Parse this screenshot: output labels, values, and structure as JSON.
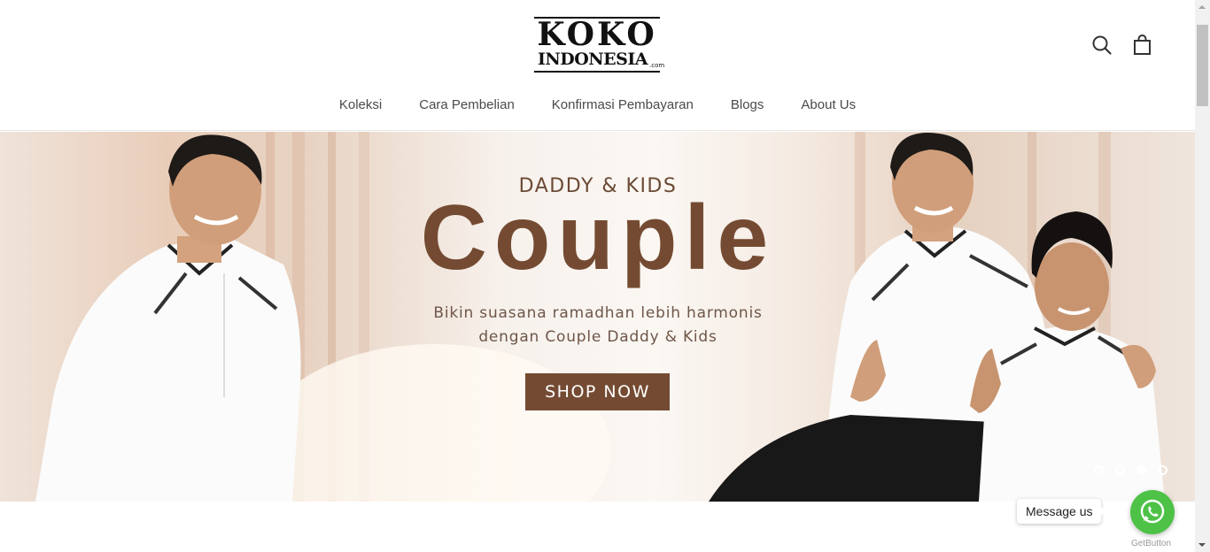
{
  "brand": {
    "logo_line1": "KOKO",
    "logo_line2": "INDONESIA",
    "logo_suffix": ".com"
  },
  "header": {
    "icons": [
      "search-icon",
      "shopping-bag-icon"
    ]
  },
  "nav": {
    "items": [
      {
        "label": "Koleksi"
      },
      {
        "label": "Cara Pembelian"
      },
      {
        "label": "Konfirmasi Pembayaran"
      },
      {
        "label": "Blogs"
      },
      {
        "label": "About Us"
      }
    ]
  },
  "hero": {
    "eyebrow": "DADDY & KIDS",
    "headline": "Couple",
    "subtext_line1": "Bikin suasana ramadhan lebih harmonis",
    "subtext_line2": "dengan Couple Daddy & Kids",
    "cta_label": "SHOP NOW",
    "slides_count": 4,
    "active_slide": 3
  },
  "chat_widget": {
    "label": "Message us",
    "provider": "GetButton",
    "icon": "whatsapp-icon"
  },
  "colors": {
    "brand_brown": "#744b32",
    "whatsapp_green": "#4dc247",
    "nav_text": "#4a4a4a"
  }
}
